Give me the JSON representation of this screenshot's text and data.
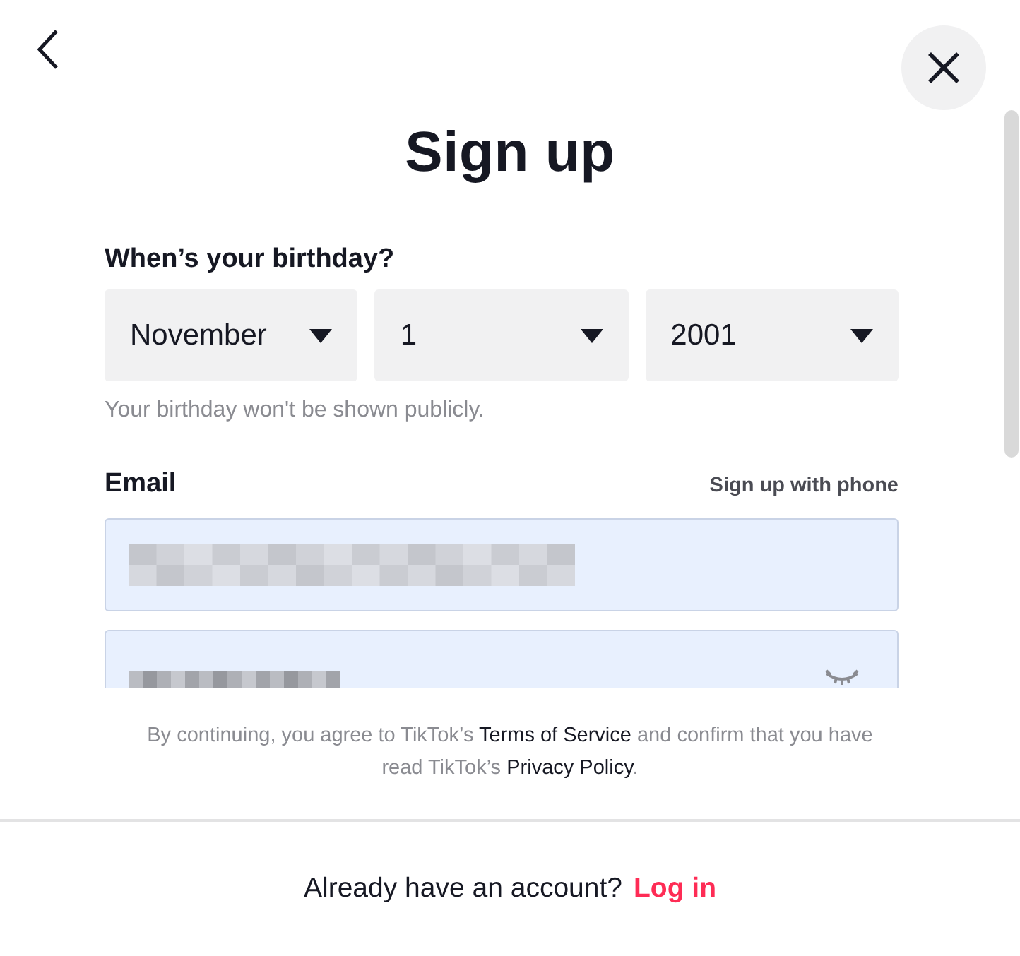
{
  "title": "Sign up",
  "birthday": {
    "label": "When’s your birthday?",
    "selects": [
      {
        "value": "November"
      },
      {
        "value": "1"
      },
      {
        "value": "2001"
      }
    ],
    "hint": "Your birthday won't be shown publicly."
  },
  "email": {
    "label": "Email",
    "switch_link": "Sign up with phone"
  },
  "fields": [
    {
      "kind": "email"
    },
    {
      "kind": "password"
    }
  ],
  "terms": [
    {
      "kind": "text",
      "text": "By continuing, you agree to TikTok’s "
    },
    {
      "kind": "link",
      "text": "Terms of Service"
    },
    {
      "kind": "text",
      "text": " and confirm that you have read TikTok’s "
    },
    {
      "kind": "link",
      "text": "Privacy Policy"
    },
    {
      "kind": "text",
      "text": "."
    }
  ],
  "footer": {
    "text": "Already have an account?",
    "link": "Log in"
  }
}
